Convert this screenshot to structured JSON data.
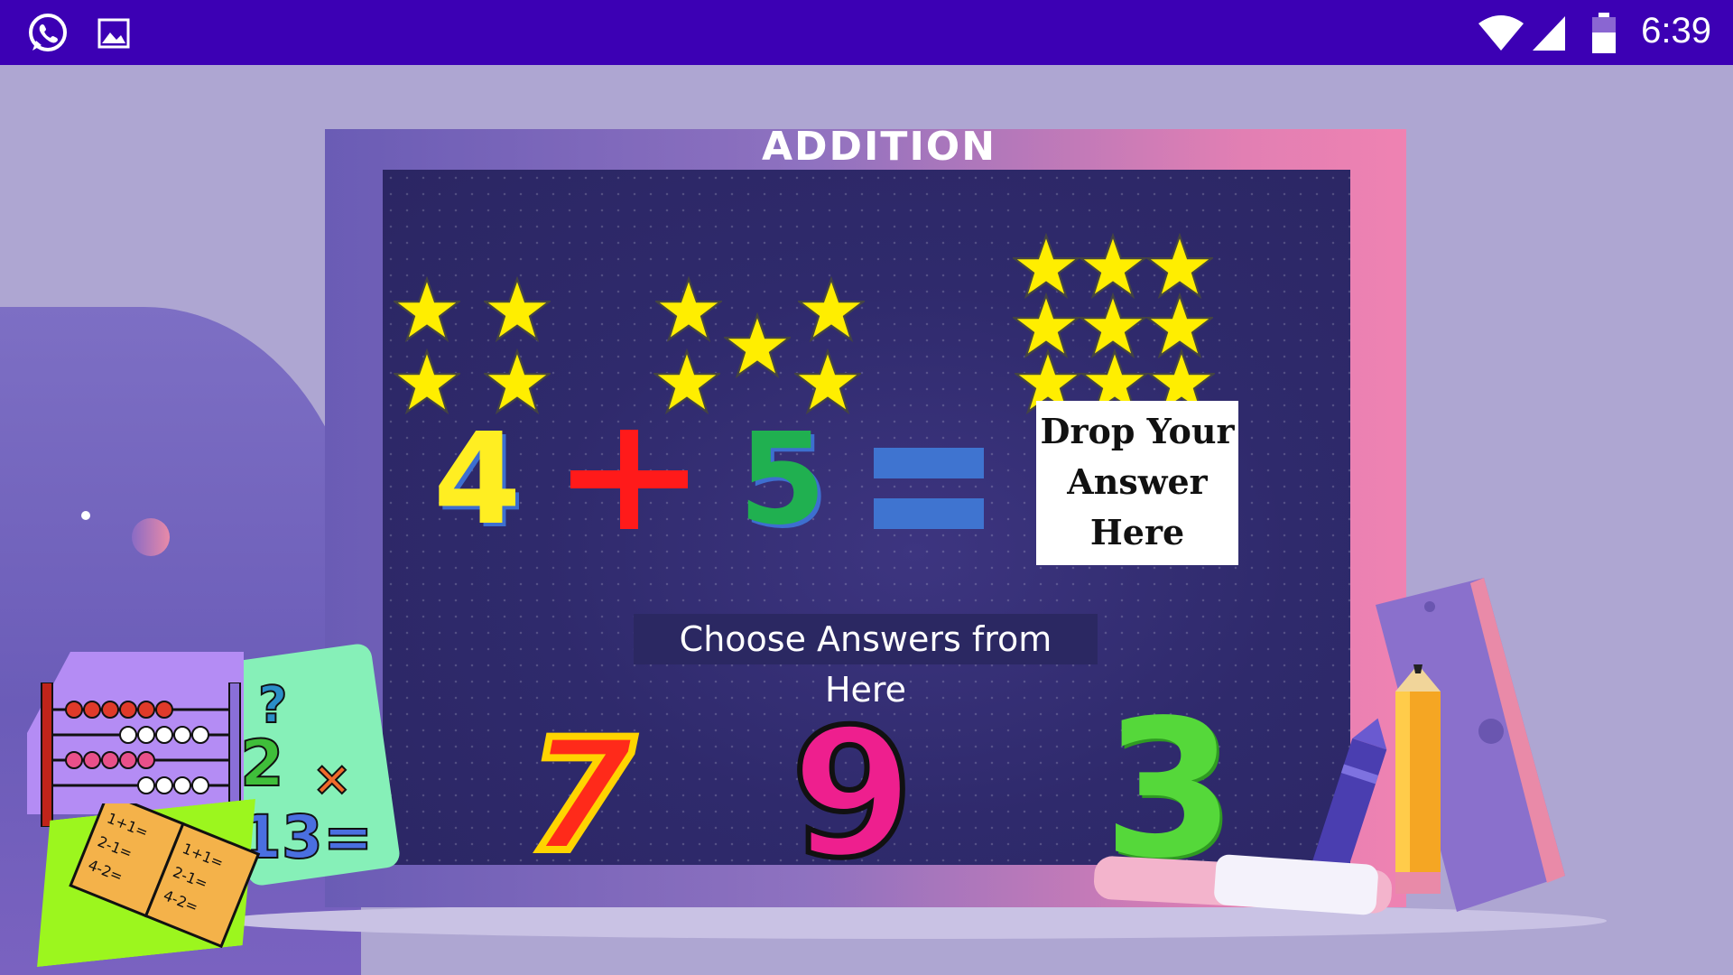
{
  "status_bar": {
    "time": "6:39",
    "icons": [
      "whatsapp-icon",
      "gallery-icon",
      "wifi-icon",
      "signal-icon",
      "battery-icon"
    ]
  },
  "game": {
    "title": "ADDITION",
    "equation": {
      "addend_1": "4",
      "operator": "+",
      "addend_2": "5",
      "equals": "="
    },
    "star_counts": {
      "left_group": 4,
      "middle_group": 5,
      "result_group": 9
    },
    "drop_zone": {
      "line1": "Drop Your",
      "line2": "Answer",
      "line3": "Here"
    },
    "choices_label": "Choose Answers from Here",
    "choices": [
      "7",
      "9",
      "3"
    ]
  },
  "colors": {
    "status_bar": "#3c00b4",
    "background": "#aea6d2",
    "star": "#ffee00",
    "addend_1": "#ffee22",
    "operator": "#ff1a1a",
    "addend_2": "#20b050",
    "equals": "#3f74d0",
    "choice_7": "#ff2a1a",
    "choice_9": "#ee1f8e",
    "choice_3": "#55d83a"
  }
}
